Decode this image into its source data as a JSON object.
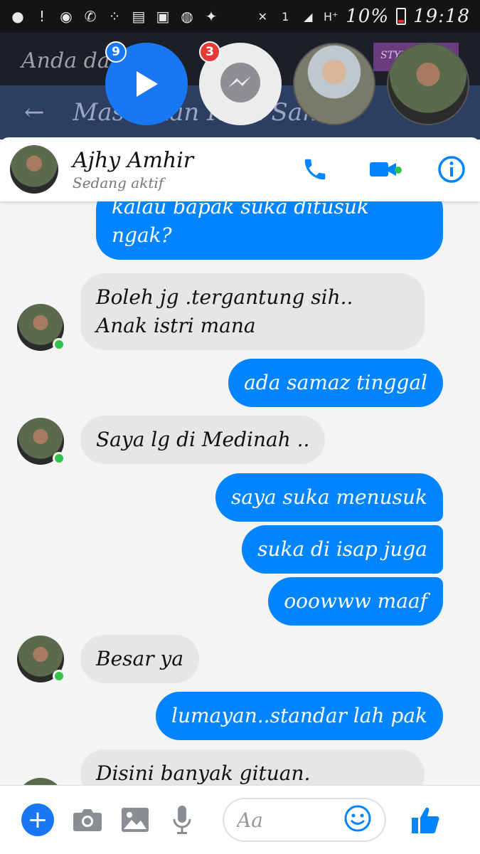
{
  "status_bar": {
    "battery": "10%",
    "time": "19:18",
    "icons": [
      "message-icon",
      "alert-icon",
      "circle-icon",
      "whatsapp-icon",
      "bbm-icon",
      "download-icon",
      "image-icon",
      "messenger-icon",
      "twitter-icon"
    ],
    "right_icons": [
      "mute-icon",
      "sim-icon",
      "signal-icon",
      "network-icon",
      "battery-icon"
    ]
  },
  "background_app": {
    "banner_text": "Anda dal… le…",
    "promo_text": "STYLE M…",
    "nav_text": "Masukkan Kata Sandi"
  },
  "chat_heads": {
    "play_badge": "9",
    "messenger_badge": "3"
  },
  "conversation": {
    "name": "Ajhy Amhir",
    "status": "Sedang aktif"
  },
  "messages": [
    {
      "dir": "out",
      "lines": [
        "kalau bapak suka ditusuk",
        "ngak?"
      ]
    },
    {
      "dir": "in",
      "lines": [
        "Boleh jg .tergantung sih..",
        "Anak istri mana"
      ]
    },
    {
      "dir": "out",
      "lines": [
        "ada samaz tinggal"
      ]
    },
    {
      "dir": "in",
      "lines": [
        "Saya lg di Medinah .."
      ]
    },
    {
      "dir": "out",
      "lines": [
        "saya suka menusuk"
      ]
    },
    {
      "dir": "out",
      "lines": [
        "suka di isap juga"
      ]
    },
    {
      "dir": "out",
      "lines": [
        "ooowww maaf"
      ]
    },
    {
      "dir": "in",
      "lines": [
        "Besar ya"
      ]
    },
    {
      "dir": "out",
      "lines": [
        "lumayan..standar lah pak"
      ]
    },
    {
      "dir": "in",
      "lines": [
        "Disini banyak gituan."
      ]
    }
  ],
  "composer": {
    "placeholder": "Aa"
  },
  "colors": {
    "accent": "#0084ff",
    "incoming_bubble": "#e6e6e8",
    "online": "#33c24a"
  }
}
